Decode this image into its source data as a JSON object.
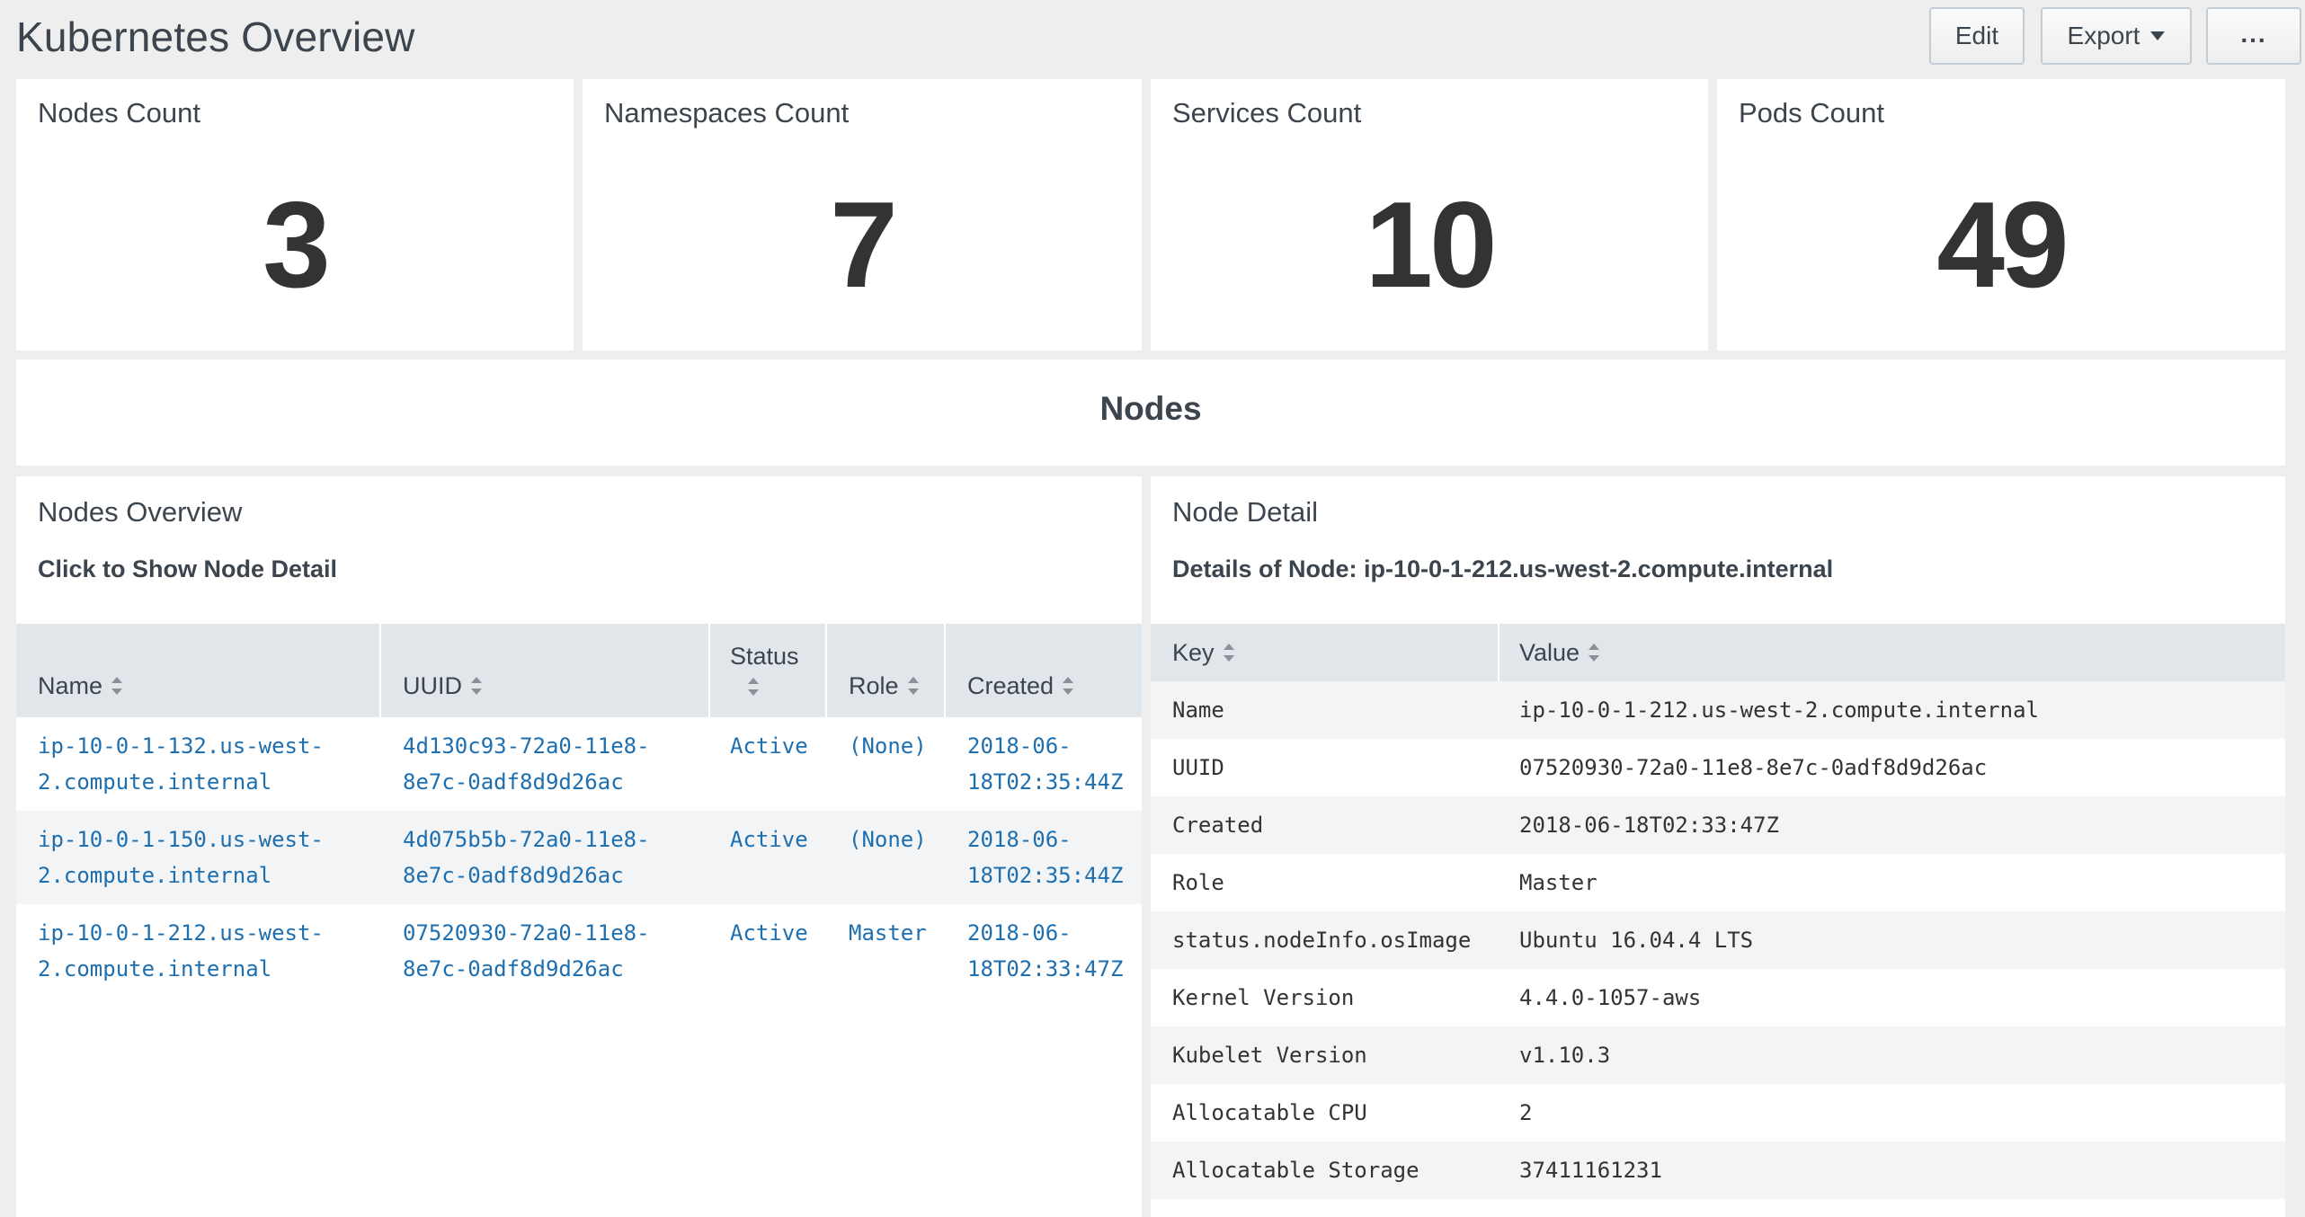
{
  "header": {
    "title": "Kubernetes Overview",
    "edit_label": "Edit",
    "export_label": "Export",
    "more_label": "..."
  },
  "single_values": [
    {
      "title": "Nodes Count",
      "value": "3"
    },
    {
      "title": "Namespaces Count",
      "value": "7"
    },
    {
      "title": "Services Count",
      "value": "10"
    },
    {
      "title": "Pods Count",
      "value": "49"
    }
  ],
  "section": {
    "title": "Nodes"
  },
  "nodes_overview": {
    "title": "Nodes Overview",
    "subtitle": "Click to Show Node Detail",
    "columns": [
      "Name",
      "UUID",
      "Status",
      "Role",
      "Created"
    ],
    "rows": [
      {
        "name_1": "ip-10-0-1-132.us-west-",
        "name_2": "2.compute.internal",
        "uuid_1": "4d130c93-72a0-11e8-",
        "uuid_2": "8e7c-0adf8d9d26ac",
        "status": "Active",
        "role": "(None)",
        "created_1": "2018-06-",
        "created_2": "18T02:35:44Z"
      },
      {
        "name_1": "ip-10-0-1-150.us-west-",
        "name_2": "2.compute.internal",
        "uuid_1": "4d075b5b-72a0-11e8-",
        "uuid_2": "8e7c-0adf8d9d26ac",
        "status": "Active",
        "role": "(None)",
        "created_1": "2018-06-",
        "created_2": "18T02:35:44Z"
      },
      {
        "name_1": "ip-10-0-1-212.us-west-",
        "name_2": "2.compute.internal",
        "uuid_1": "07520930-72a0-11e8-",
        "uuid_2": "8e7c-0adf8d9d26ac",
        "status": "Active",
        "role": "Master",
        "created_1": "2018-06-",
        "created_2": "18T02:33:47Z"
      }
    ]
  },
  "node_detail": {
    "title": "Node Detail",
    "subtitle": "Details of Node: ip-10-0-1-212.us-west-2.compute.internal",
    "columns": [
      "Key",
      "Value"
    ],
    "rows": [
      {
        "key": "Name",
        "value": "ip-10-0-1-212.us-west-2.compute.internal"
      },
      {
        "key": "UUID",
        "value": "07520930-72a0-11e8-8e7c-0adf8d9d26ac"
      },
      {
        "key": "Created",
        "value": "2018-06-18T02:33:47Z"
      },
      {
        "key": "Role",
        "value": "Master"
      },
      {
        "key": "status.nodeInfo.osImage",
        "value": "Ubuntu 16.04.4 LTS"
      },
      {
        "key": "Kernel Version",
        "value": "4.4.0-1057-aws"
      },
      {
        "key": "Kubelet Version",
        "value": "v1.10.3"
      },
      {
        "key": "Allocatable CPU",
        "value": "2"
      },
      {
        "key": "Allocatable Storage",
        "value": "37411161231"
      }
    ]
  },
  "colors": {
    "background": "#eeeeee",
    "panel": "#ffffff",
    "table_header": "#e1e6eb",
    "link": "#1e6fb0",
    "text": "#3c444d"
  }
}
